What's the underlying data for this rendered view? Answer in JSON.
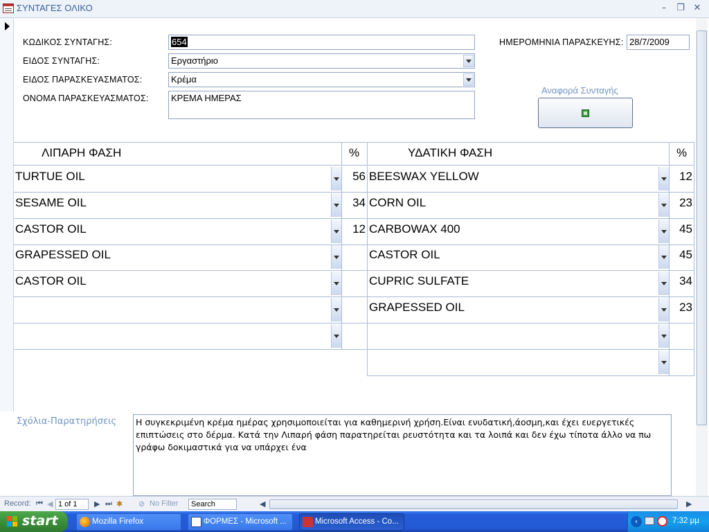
{
  "window": {
    "title": "ΣΥΝΤΑΓΕΣ ΟΛΙΚΟ",
    "minimize": "–",
    "restore": "❐",
    "close": "✕"
  },
  "form": {
    "code_label": "ΚΩΔΙΚΟΣ ΣΥΝΤΑΓΗΣ:",
    "code_value": "654",
    "type_label": "ΕΙΔΟΣ ΣΥΝΤΑΓΗΣ:",
    "type_value": "Εργαστήριο",
    "prep_type_label": "ΕΙΔΟΣ ΠΑΡΑΣΚΕΥΑΣΜΑΤΟΣ:",
    "prep_type_value": "Κρέμα",
    "prep_name_label": "ΟΝΟΜΑ ΠΑΡΑΣΚΕΥΑΣΜΑΤΟΣ:",
    "prep_name_value": "ΚΡΕΜΑ ΗΜΕΡΑΣ",
    "date_label": "ΗΜΕΡΟΜΗΝΙΑ ΠΑΡΑΣΚΕΥΗΣ:",
    "date_value": "28/7/2009",
    "report_label": "Αναφορά Συνταγής"
  },
  "lipid": {
    "header": "ΛΙΠΑΡΗ ΦΑΣΗ",
    "pct_header": "%",
    "rows": [
      {
        "name": "TURTUE OIL",
        "pct": "56"
      },
      {
        "name": "SESAME OIL",
        "pct": "34"
      },
      {
        "name": "CASTOR OIL",
        "pct": "12"
      },
      {
        "name": "GRAPESSED OIL",
        "pct": ""
      },
      {
        "name": "CASTOR OIL",
        "pct": ""
      },
      {
        "name": "",
        "pct": ""
      },
      {
        "name": "",
        "pct": ""
      }
    ]
  },
  "aqueous": {
    "header": "ΥΔΑΤΙΚΗ ΦΑΣΗ",
    "pct_header": "%",
    "rows": [
      {
        "name": "BEESWAX YELLOW",
        "pct": "12"
      },
      {
        "name": "CORN OIL",
        "pct": "23"
      },
      {
        "name": "CARBOWAX 400",
        "pct": "45"
      },
      {
        "name": "CASTOR OIL",
        "pct": "45"
      },
      {
        "name": "CUPRIC SULFATE",
        "pct": "34"
      },
      {
        "name": "GRAPESSED OIL",
        "pct": "23"
      },
      {
        "name": "",
        "pct": ""
      },
      {
        "name": "",
        "pct": ""
      }
    ]
  },
  "comments": {
    "label": "Σχόλια-Παρατηρήσεις",
    "text": "Η συγκεκριμένη κρέμα ημέρας χρησιμοποιείται για καθημερινή χρήση.Είναι ενυδατική,άοσμη,και έχει ευεργετικές επιπτώσεις στο δέρμα. Κατά την Λιπαρή φάση παρατηρείται ρευστότητα και τα λοιπά και δεν έχω τίποτα άλλο να πω γράφω δοκιμαστικά για να υπάρχει ένα"
  },
  "navbar": {
    "record_label": "Record:",
    "current": "1 of 1",
    "filter": "No Filter",
    "search_placeholder": "Search"
  },
  "taskbar": {
    "start": "start",
    "tasks": [
      {
        "label": "Mozilla Firefox",
        "active": false
      },
      {
        "label": "ΦΟΡΜΕΣ - Microsoft ...",
        "active": false
      },
      {
        "label": "Microsoft Access - Co...",
        "active": true
      }
    ],
    "clock": "7:32 μμ"
  }
}
